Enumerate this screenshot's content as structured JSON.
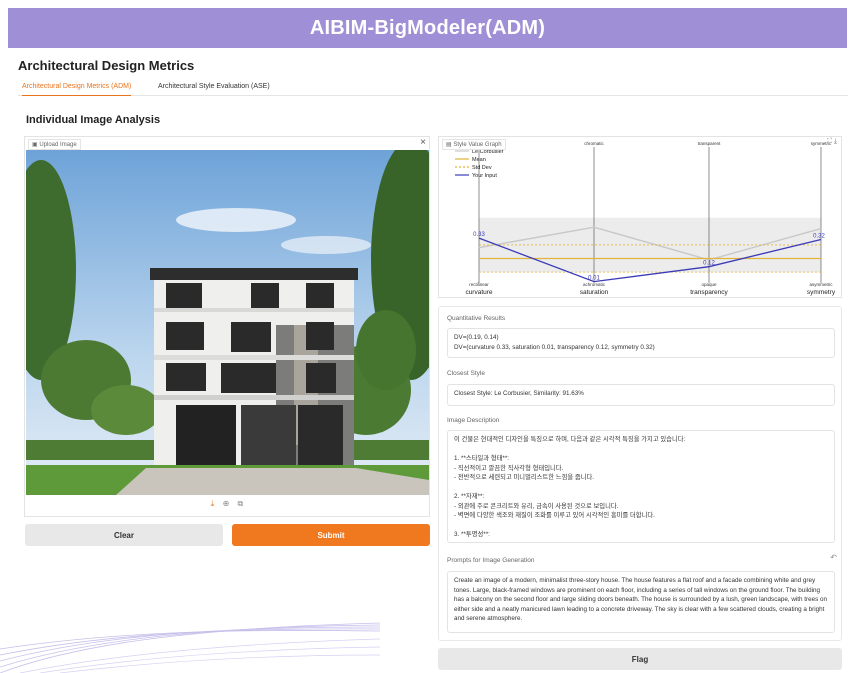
{
  "banner": {
    "title": "AIBIM-BigModeler(ADM)"
  },
  "app": {
    "title": "Architectural Design Metrics"
  },
  "tabs": [
    {
      "label": "Architectural Design Metrics (ADM)",
      "active": true
    },
    {
      "label": "Architectural Style Evaluation (ASE)",
      "active": false
    }
  ],
  "section": {
    "title": "Individual Image Analysis"
  },
  "upload": {
    "label": "Upload Image",
    "close": "×",
    "tools": [
      "download-icon",
      "share-icon",
      "copy-icon"
    ]
  },
  "buttons": {
    "clear": "Clear",
    "submit": "Submit",
    "flag": "Flag"
  },
  "graph": {
    "label": "Style Value Graph",
    "tool_icons": [
      "fullscreen-icon",
      "download-icon"
    ],
    "legend": [
      "Le Corbusier",
      "Mean",
      "Std Dev",
      "Your Input"
    ],
    "colors": {
      "mean": "#e0b43a",
      "std": "#e0b43a",
      "input": "#3b3bb8",
      "corbusier": "#c8c8c8",
      "band": "#ececec"
    }
  },
  "chart_data": {
    "type": "line",
    "title": "",
    "axes": [
      "curvature",
      "saturation",
      "transparency",
      "symmetry"
    ],
    "axis_top_labels": [
      "",
      "chromatic",
      "transparent",
      "symmetric"
    ],
    "axis_bottom_labels": [
      "rectilinear",
      "achromatic",
      "opaque",
      "asymmetric"
    ],
    "ylim": [
      0,
      1
    ],
    "series": [
      {
        "name": "Your Input",
        "values": [
          0.33,
          0.01,
          0.12,
          0.32
        ]
      },
      {
        "name": "Mean",
        "values": [
          0.18,
          0.18,
          0.18,
          0.18
        ]
      },
      {
        "name": "Std Dev",
        "values": [
          0.28,
          0.28,
          0.28,
          0.28
        ]
      },
      {
        "name": "Le Corbusier",
        "values": [
          0.26,
          0.41,
          0.17,
          0.4
        ]
      }
    ],
    "data_labels": [
      "0.33",
      "0.01",
      "0.12",
      "0.32"
    ]
  },
  "results": {
    "quant_label": "Quantitative Results",
    "quant_lines": [
      "DV=(0.19, 0.14)",
      "DV=(curvature 0.33, saturation 0.01, transparency 0.12, symmetry 0.32)"
    ],
    "closest_label": "Closest Style",
    "closest_value": "Closest Style: Le Corbusier, Similarity: 91.63%",
    "desc_label": "Image Description",
    "desc_lines": [
      "이 건물은 현대적인 디자인을 특징으로 하며, 다음과 같은 시각적 특징을 가지고 있습니다:",
      "",
      "1. **스타일과 형태**:",
      "  - 직선적이고 깔끔한 직사각형 형태입니다.",
      "  - 전반적으로 세련되고 미니멀리스트한 느낌을 줍니다.",
      "",
      "2. **자재**:",
      "  - 외관에 주로 콘크리트와 유리, 금속이 사용된 것으로 보입니다.",
      "  - 벽면에 다양한 색조와 재질이 조화를 이루고 있어 시각적인 흥미를 더합니다.",
      "",
      "3. **투명성**:"
    ],
    "prompt_label": "Prompts for Image Generation",
    "prompt_text": "Create an image of a modern, minimalist three-story house. The house features a flat roof and a facade combining white and grey tones. Large, black-framed windows are prominent on each floor, including a series of tall windows on the ground floor. The building has a balcony on the second floor and large sliding doors beneath. The house is surrounded by a lush, green landscape, with trees on either side and a neatly manicured lawn leading to a concrete driveway. The sky is clear with a few scattered clouds, creating a bright and serene atmosphere."
  }
}
